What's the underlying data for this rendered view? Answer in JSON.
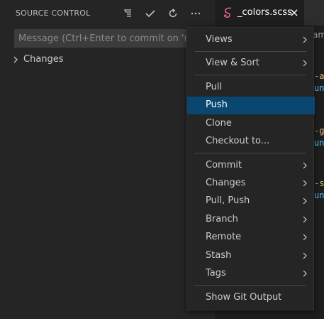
{
  "source_control": {
    "title": "SOURCE CONTROL",
    "actions": {
      "view_as_tree": "view-as-tree",
      "commit": "commit",
      "refresh": "refresh",
      "more": "..."
    },
    "message_placeholder": "Message (Ctrl+Enter to commit on 'nick-r",
    "changes_label": "Changes"
  },
  "editor": {
    "tab_label": "_colors.scss",
    "tab_close": "×",
    "breadcrumb_fragment": "am",
    "code_fragments": [
      {
        "text": "-ar",
        "color": "orange"
      },
      {
        "text": "unc",
        "color": "blue"
      },
      {
        "text": "-gr",
        "color": "orange"
      },
      {
        "text": "unc",
        "color": "blue"
      },
      {
        "text": "-se",
        "color": "orange"
      },
      {
        "text": "unc",
        "color": "blue"
      }
    ]
  },
  "menu": {
    "groups": [
      [
        {
          "label": "Views",
          "submenu": true
        }
      ],
      [
        {
          "label": "View & Sort",
          "submenu": true
        }
      ],
      [
        {
          "label": "Pull",
          "submenu": false
        },
        {
          "label": "Push",
          "submenu": false,
          "active": true
        },
        {
          "label": "Clone",
          "submenu": false
        },
        {
          "label": "Checkout to...",
          "submenu": false
        }
      ],
      [
        {
          "label": "Commit",
          "submenu": true
        },
        {
          "label": "Changes",
          "submenu": true
        },
        {
          "label": "Pull, Push",
          "submenu": true
        },
        {
          "label": "Branch",
          "submenu": true
        },
        {
          "label": "Remote",
          "submenu": true
        },
        {
          "label": "Stash",
          "submenu": true
        },
        {
          "label": "Tags",
          "submenu": true
        }
      ],
      [
        {
          "label": "Show Git Output",
          "submenu": false
        }
      ]
    ]
  },
  "colors": {
    "menu_active": "#094771",
    "sidebar_bg": "#252526",
    "editor_bg": "#1e1e1e",
    "input_bg": "#3c3c3c",
    "scss_icon": "#f06292"
  }
}
